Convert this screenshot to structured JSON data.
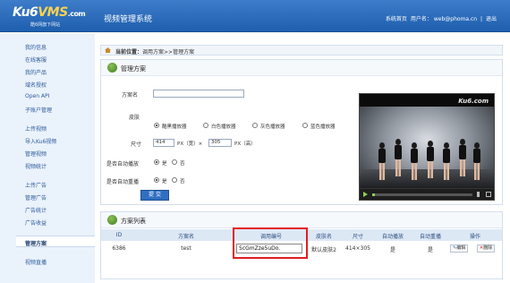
{
  "header": {
    "logo_main": "Ku6",
    "logo_v": "VMS",
    "logo_com": ".com",
    "logo_slogan": "酷6网旗下网站",
    "system_title": "视频管理系统",
    "links": {
      "home": "系统首页",
      "user_label": "用户名：",
      "user_email": "web@phoma.cn",
      "separator": "|",
      "logout": "退出"
    }
  },
  "sidebar": {
    "items": [
      {
        "label": "我的信息"
      },
      {
        "label": "在线客服"
      },
      {
        "label": "我的产品"
      },
      {
        "label": "域名授权"
      },
      {
        "label": "Open API"
      },
      {
        "label": "子账户管理"
      },
      {
        "label": "上传视频"
      },
      {
        "label": "导入Ku6视频"
      },
      {
        "label": "管理视频"
      },
      {
        "label": "视频统计"
      },
      {
        "label": "上传广告"
      },
      {
        "label": "管理广告"
      },
      {
        "label": "广告统计"
      },
      {
        "label": "广告收益"
      },
      {
        "label": "管理方案"
      },
      {
        "label": "视频直播"
      }
    ]
  },
  "breadcrumb": {
    "prefix": "当前位置：",
    "path": "调用方案>>管理方案"
  },
  "manage_section": {
    "title": "管理方案",
    "scheme_name_label": "方案名",
    "scheme_name_value": "",
    "skin_label": "皮肤",
    "skins": [
      "酷黑播放器",
      "白色播放器",
      "灰色播放器",
      "蓝色播放器"
    ],
    "skin_selected": 0,
    "size_label": "尺寸",
    "width_value": "414",
    "width_unit": "PX（宽）×",
    "height_value": "305",
    "height_unit": "PX（高）",
    "autoplay_label": "是否自动播放",
    "autoreplay_label": "是否自动重播",
    "yes": "是",
    "no": "否",
    "submit_label": "提 交"
  },
  "player": {
    "brand": "Ku6.com",
    "progress": 0.02
  },
  "list_section": {
    "title": "方案列表",
    "columns": [
      "ID",
      "方案名",
      "调用编号",
      "皮肤名",
      "尺寸",
      "自动播放",
      "自动重播",
      "操作"
    ],
    "rows": [
      {
        "id": "6386",
        "name": "test",
        "code": "5cGmZze5uDo.",
        "skin": "默认皮肤2",
        "size": "414×305",
        "autoplay": "是",
        "autoreplay": "是",
        "edit": "编辑",
        "delete": "删除"
      }
    ]
  },
  "colors": {
    "header": "#2a6dbd",
    "highlight_border": "#e31c23",
    "submit_button": "#2f6fc2"
  }
}
